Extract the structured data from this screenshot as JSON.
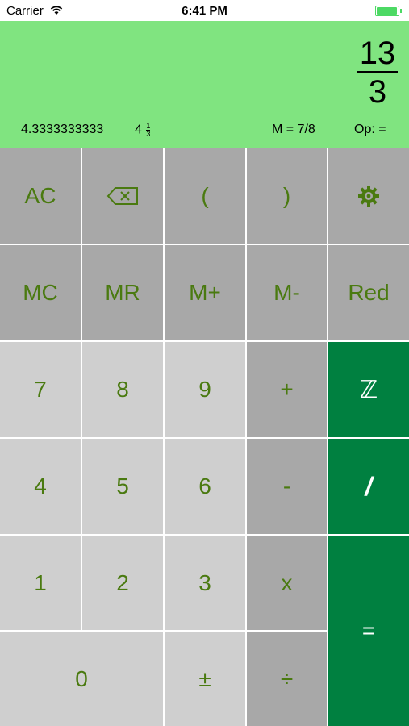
{
  "status_bar": {
    "carrier": "Carrier",
    "time": "6:41 PM",
    "battery_level": 1.0
  },
  "display": {
    "fraction": {
      "numerator": "13",
      "denominator": "3"
    },
    "decimal": "4.3333333333",
    "mixed": {
      "whole": "4",
      "numerator": "1",
      "denominator": "3"
    },
    "memory": "M = 7/8",
    "operation": "Op: ="
  },
  "keys": {
    "ac": "AC",
    "backspace": "backspace-icon",
    "open_paren": "(",
    "close_paren": ")",
    "settings": "gear-icon",
    "mc": "MC",
    "mr": "MR",
    "m_plus": "M+",
    "m_minus": "M-",
    "red": "Red",
    "seven": "7",
    "eight": "8",
    "nine": "9",
    "plus": "+",
    "integer": "ℤ",
    "four": "4",
    "five": "5",
    "six": "6",
    "minus": "-",
    "fraction_slash": "/",
    "one": "1",
    "two": "2",
    "three": "3",
    "times": "x",
    "zero": "0",
    "plus_minus": "±",
    "divide": "÷",
    "equals": "="
  },
  "colors": {
    "display_bg": "#80e480",
    "key_dark": "#a8a8a8",
    "key_light": "#cfcfcf",
    "key_green": "#008040",
    "key_text": "#4a7a10"
  }
}
